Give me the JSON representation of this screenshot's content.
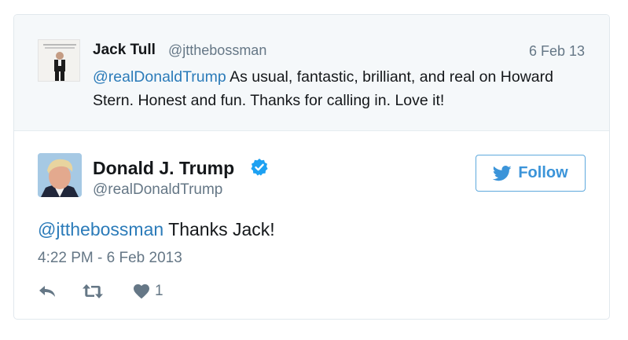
{
  "quoted_tweet": {
    "author_name": "Jack Tull",
    "author_handle": "@jtthebossman",
    "date": "6 Feb 13",
    "mention": "@realDonaldTrump",
    "text": "As usual, fantastic, brilliant, and real on Howard Stern. Honest and fun. Thanks for calling in. Love it!"
  },
  "main_tweet": {
    "author_name": "Donald J. Trump",
    "author_handle": "@realDonaldTrump",
    "verified": true,
    "follow_label": "Follow",
    "mention": "@jtthebossman",
    "text": "Thanks Jack!",
    "timestamp": "4:22 PM - 6 Feb 2013",
    "like_count": "1"
  },
  "icons": {
    "verified": "verified-badge-icon",
    "follow": "twitter-bird-icon",
    "reply": "reply-icon",
    "retweet": "retweet-icon",
    "like": "heart-icon"
  },
  "colors": {
    "link": "#2b7bb9",
    "follow_accent": "#3b94d9",
    "muted_text": "#657786",
    "quoted_background": "#f5f8fa",
    "border": "#e1e8ed"
  }
}
